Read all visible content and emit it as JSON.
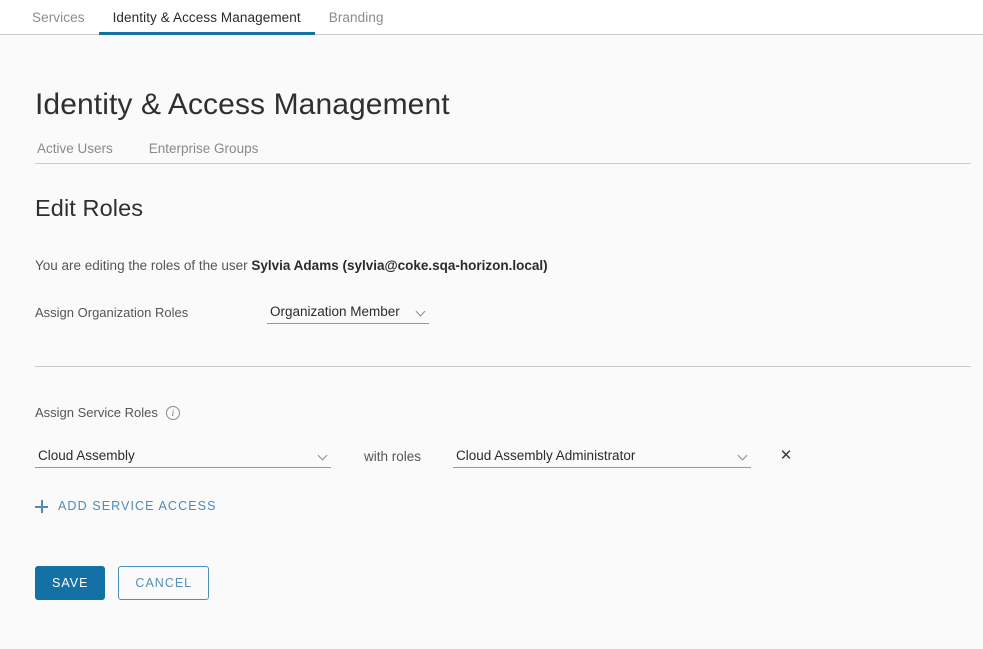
{
  "topbar": {
    "tabs": [
      {
        "label": "Services",
        "active": false
      },
      {
        "label": "Identity & Access Management",
        "active": true
      },
      {
        "label": "Branding",
        "active": false
      }
    ]
  },
  "page": {
    "title": "Identity & Access Management",
    "subtabs": [
      {
        "label": "Active Users"
      },
      {
        "label": "Enterprise Groups"
      }
    ],
    "section_title": "Edit Roles",
    "edit_note_prefix": "You are editing the roles of the user ",
    "edit_note_user": "Sylvia Adams (sylvia@coke.sqa-horizon.local)"
  },
  "org_roles": {
    "label": "Assign Organization Roles",
    "selected": "Organization Member",
    "chevron_icon": "chevron-down-icon"
  },
  "service_roles": {
    "label": "Assign Service Roles",
    "info_icon": "info-circle-icon",
    "info_glyph": "i",
    "with_roles_label": "with roles",
    "rows": [
      {
        "service": "Cloud Assembly",
        "role": "Cloud Assembly Administrator",
        "remove_icon": "close-icon",
        "remove_glyph": "✕"
      }
    ],
    "add_label": "ADD SERVICE ACCESS",
    "add_icon": "plus-icon"
  },
  "actions": {
    "save_label": "SAVE",
    "cancel_label": "CANCEL"
  },
  "colors": {
    "accent": "#1471a5",
    "link": "#4f8ab5",
    "page_bg": "#fafafa",
    "topbar_bg": "#ffffff",
    "border": "#cccccc",
    "text": "#565656",
    "heading": "#2f2f2f"
  }
}
